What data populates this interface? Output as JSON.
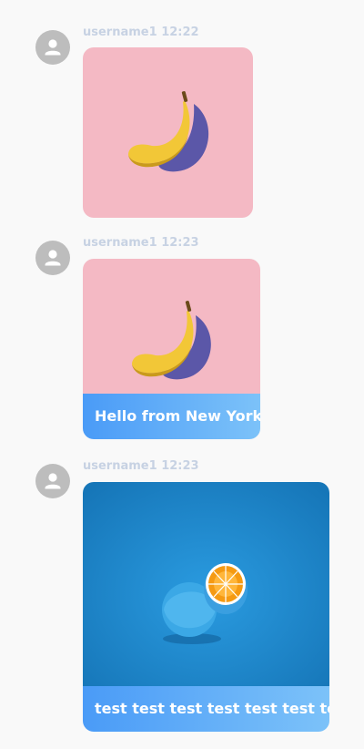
{
  "messages": [
    {
      "username": "username1",
      "time": "12:22",
      "image": "banana-on-pink-photo",
      "caption": ""
    },
    {
      "username": "username1",
      "time": "12:23",
      "image": "banana-on-pink-photo",
      "caption": "Hello from New York"
    },
    {
      "username": "username1",
      "time": "12:23",
      "image": "blue-orange-on-blue-photo",
      "caption": "test test test test test test test"
    }
  ],
  "colors": {
    "background": "#f9f9f9",
    "meta_text": "#c7d2e3",
    "avatar": "#bdbdbd",
    "caption_gradient_start": "#4a9bf7",
    "caption_gradient_end": "#7cc2f9",
    "pink_photo_bg": "#f4b9c4",
    "blue_photo_bg": "#1a85c7"
  },
  "icons": {
    "avatar": "person-icon"
  }
}
